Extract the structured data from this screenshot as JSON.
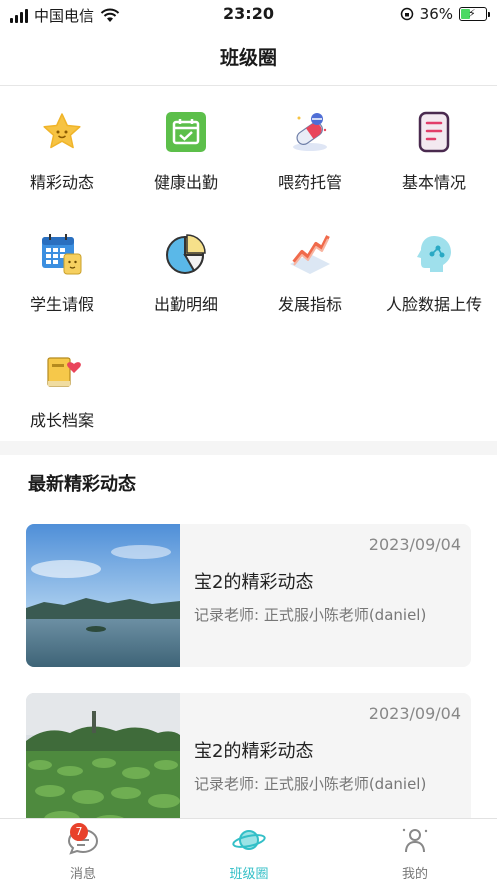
{
  "status_bar": {
    "carrier": "中国电信",
    "time": "23:20",
    "battery": "36%",
    "battery_level": 0.36,
    "icons": [
      "signal-icon",
      "wifi-icon",
      "orientation-lock-icon",
      "battery-icon"
    ]
  },
  "nav": {
    "title": "班级圈"
  },
  "grid": {
    "items": [
      {
        "label": "精彩动态",
        "icon": "star-icon"
      },
      {
        "label": "健康出勤",
        "icon": "calendar-check-icon"
      },
      {
        "label": "喂药托管",
        "icon": "medicine-icon"
      },
      {
        "label": "基本情况",
        "icon": "document-icon"
      },
      {
        "label": "学生请假",
        "icon": "leave-calendar-icon"
      },
      {
        "label": "出勤明细",
        "icon": "pie-chart-icon"
      },
      {
        "label": "发展指标",
        "icon": "growth-chart-icon"
      },
      {
        "label": "人脸数据上传",
        "icon": "face-upload-icon"
      },
      {
        "label": "成长档案",
        "icon": "growth-archive-icon"
      }
    ]
  },
  "section": {
    "title": "最新精彩动态"
  },
  "feed": [
    {
      "date": "2023/09/04",
      "title": "宝2的精彩动态",
      "subtitle": "记录老师: 正式服小陈老师(daniel)",
      "image": "lake-mountains-photo"
    },
    {
      "date": "2023/09/04",
      "title": "宝2的精彩动态",
      "subtitle": "记录老师: 正式服小陈老师(daniel)",
      "image": "lotus-pond-photo"
    }
  ],
  "tabs": [
    {
      "label": "消息",
      "icon": "message-icon",
      "badge": "7"
    },
    {
      "label": "班级圈",
      "icon": "planet-icon",
      "active": true
    },
    {
      "label": "我的",
      "icon": "profile-icon"
    }
  ],
  "colors": {
    "accent": "#33bfc7",
    "badge": "#e8412b"
  }
}
